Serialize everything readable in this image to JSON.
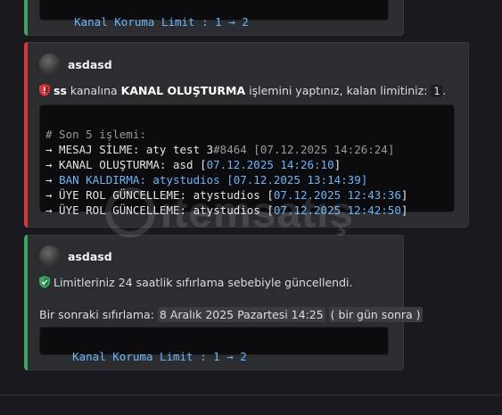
{
  "colors": {
    "background": "#1a1a1e",
    "embed_bg": "#2b2d31",
    "bar_green": "#3ba55d",
    "bar_red": "#da373c",
    "code_blue": "#6fb4f5"
  },
  "top_embed": {
    "code_line": "Kanal Koruma Limit : 1 → 2"
  },
  "warning_embed": {
    "author": "asdasd",
    "icon": "red-shield-icon",
    "desc_user": "ss",
    "desc_mid": " kanalına ",
    "desc_action": "KANAL OLUŞTURMA",
    "desc_tail": " işlemini yaptınız, kalan limitiniz: ",
    "remaining": "1",
    "desc_end": ".",
    "code": {
      "header": "# Son 5 işlemi:",
      "lines": [
        {
          "prefix": "→ MESAJ SİLME: aty test 3",
          "tag": "#8464 [07.12.2025 14:26:24]",
          "suffix": ""
        },
        {
          "prefix": "→ KANAL OLUŞTURMA: asd [",
          "tag": "07.12.2025 14:26:10",
          "suffix": "]"
        },
        {
          "prefix": "→ ",
          "tag": "BAN KALDIRMA: atystudios [07.12.2025 13:14:39]",
          "suffix": ""
        },
        {
          "prefix": "→ ÜYE ROL GÜNCELLEME: atystudios [",
          "tag": "07.12.2025 12:43:36",
          "suffix": "]"
        },
        {
          "prefix": "→ ÜYE ROL GÜNCELLEME: atystudios [",
          "tag": "07.12.2025 12:42:50",
          "suffix": "]"
        }
      ]
    }
  },
  "reset_embed": {
    "author": "asdasd",
    "icon": "green-shield-icon",
    "message": "Limitleriniz 24 saatlik sıfırlama sebebiyle güncellendi.",
    "next_label": "Bir sonraki sıfırlama: ",
    "next_date": "8 Aralık 2025 Pazartesi 14:25",
    "next_relative": "bir gün sonra",
    "code_line": "Kanal Koruma Limit : 1 → 2"
  },
  "watermark": {
    "text": "itemsatış"
  }
}
